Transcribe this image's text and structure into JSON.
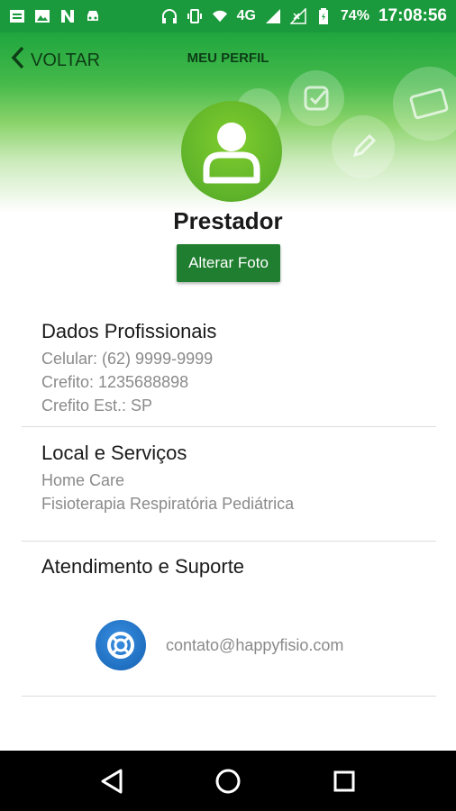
{
  "status_bar": {
    "battery": "74%",
    "time": "17:08:56",
    "network": "4G",
    "icons": [
      "message-icon",
      "image-icon",
      "n-icon",
      "car-icon",
      "headphones-icon",
      "vibrate-icon",
      "wifi-icon",
      "signal-icon",
      "no-signal-icon",
      "battery-icon"
    ]
  },
  "header": {
    "back_label": "VOLTAR",
    "title": "MEU PERFIL"
  },
  "profile": {
    "name": "Prestador",
    "change_photo_label": "Alterar Foto"
  },
  "sections": {
    "professional": {
      "title": "Dados Profissionais",
      "phone": "Celular: (62) 9999-9999",
      "crefito": "Crefito: 1235688898",
      "crefito_state": "Crefito Est.: SP"
    },
    "services": {
      "title": "Local e Serviços",
      "location": "Home Care",
      "service": "Fisioterapia Respiratória Pediátrica"
    },
    "support": {
      "title": "Atendimento e Suporte",
      "email": "contato@happyfisio.com"
    }
  },
  "colors": {
    "status_bar": "#1a9a3c",
    "button": "#1f7e2f",
    "avatar": "#6bbf2c",
    "support_icon": "#1f6fc1"
  }
}
